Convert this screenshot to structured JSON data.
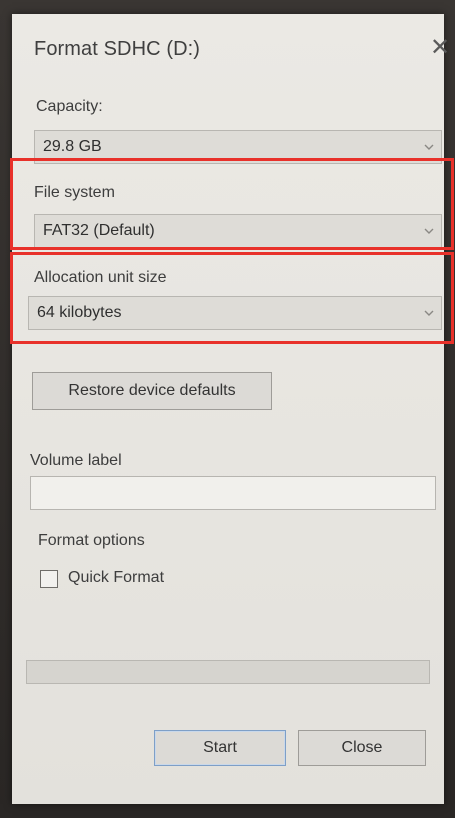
{
  "window": {
    "title": "Format SDHC (D:)",
    "close_glyph": "✕"
  },
  "capacity": {
    "label": "Capacity:",
    "value": "29.8 GB"
  },
  "file_system": {
    "label": "File system",
    "value": "FAT32 (Default)"
  },
  "allocation": {
    "label": "Allocation unit size",
    "value": "64 kilobytes"
  },
  "restore_button": "Restore device defaults",
  "volume_label": {
    "label": "Volume label",
    "value": ""
  },
  "format_options": {
    "label": "Format options",
    "quick_format_label": "Quick Format",
    "quick_format_checked": false
  },
  "progress": {
    "value": 0
  },
  "buttons": {
    "start": "Start",
    "close": "Close"
  },
  "colors": {
    "highlight": "#e8312a"
  },
  "icons": {
    "dropdown": "chevron-down-icon",
    "close": "close-icon"
  }
}
